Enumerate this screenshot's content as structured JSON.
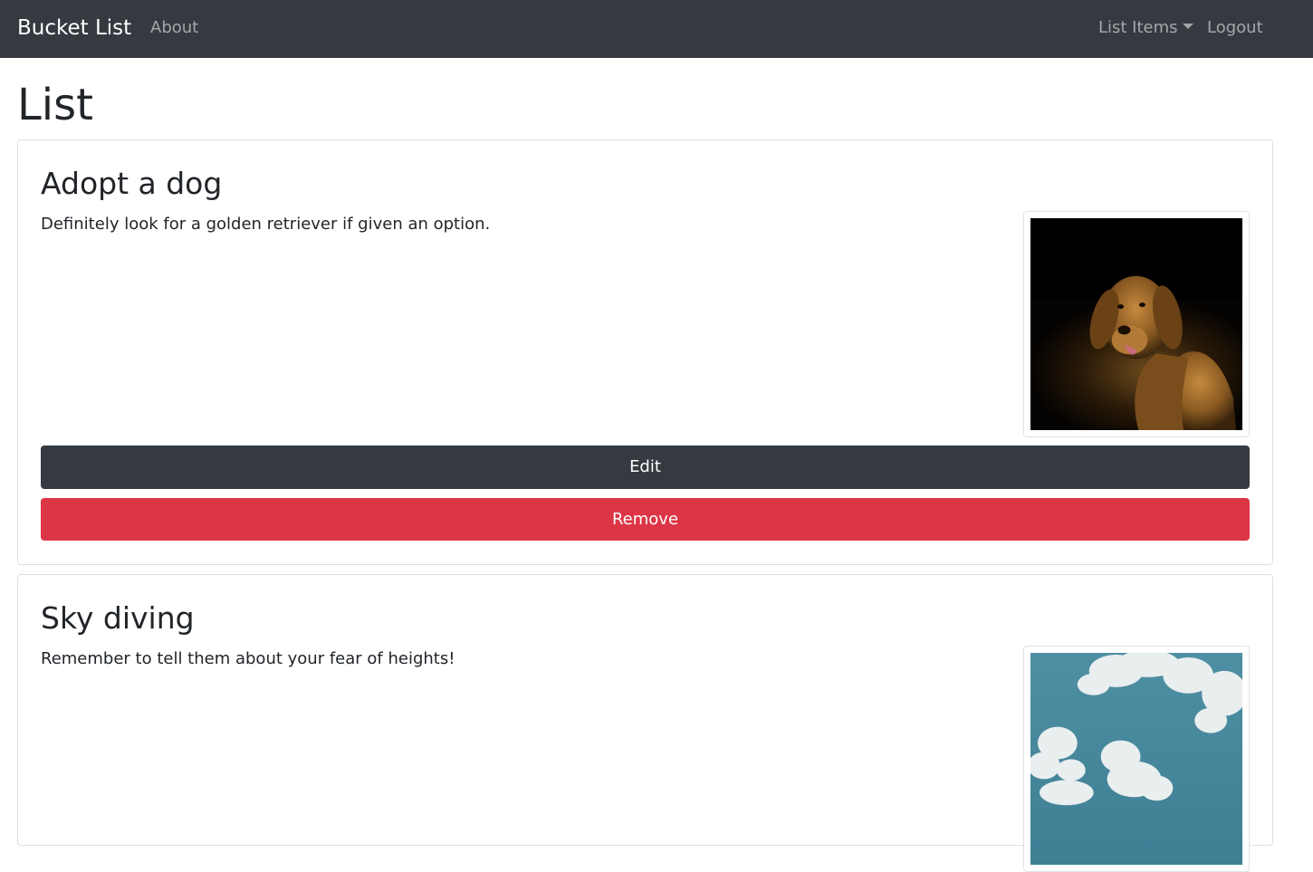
{
  "navbar": {
    "brand": "Bucket List",
    "about": "About",
    "list_items": "List Items",
    "logout": "Logout"
  },
  "page": {
    "title": "List"
  },
  "items": [
    {
      "title": "Adopt a dog",
      "description": "Definitely look for a golden retriever if given an option.",
      "edit_label": "Edit",
      "remove_label": "Remove"
    },
    {
      "title": "Sky diving",
      "description": "Remember to tell them about your fear of heights!"
    }
  ],
  "colors": {
    "navbar_bg": "#343a40",
    "edit_button": "#343a40",
    "remove_button": "#dc3545"
  }
}
